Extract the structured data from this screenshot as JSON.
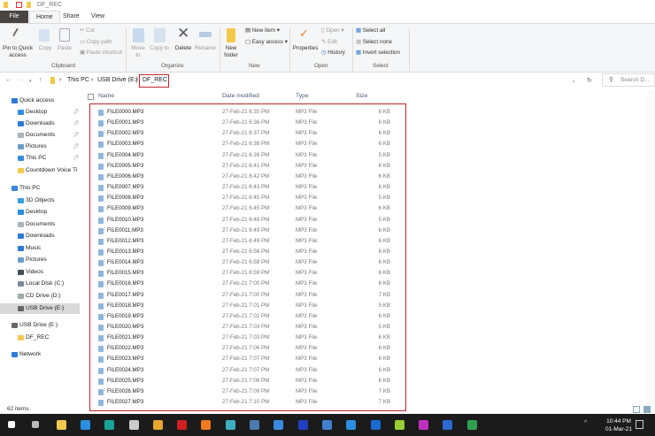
{
  "window": {
    "title": "DF_REC"
  },
  "tabs": [
    "File",
    "Home",
    "Share",
    "View"
  ],
  "ribbon": {
    "clipboard": {
      "pin": "Pin to Quick access",
      "copy": "Copy",
      "paste": "Paste",
      "cut": "Cut",
      "copy_path": "Copy path",
      "paste_shortcut": "Paste shortcut",
      "label": "Clipboard"
    },
    "organize": {
      "move_to": "Move to",
      "copy_to": "Copy to",
      "delete": "Delete",
      "rename": "Rename",
      "label": "Organize"
    },
    "new": {
      "new_folder": "New folder",
      "new_item": "New item",
      "easy_access": "Easy access",
      "label": "New"
    },
    "open": {
      "properties": "Properties",
      "open": "Open",
      "edit": "Edit",
      "history": "History",
      "label": "Open"
    },
    "select": {
      "select_all": "Select all",
      "select_none": "Select none",
      "invert": "Invert selection",
      "label": "Select"
    }
  },
  "address": {
    "crumbs": [
      "This PC",
      "USB Drive (E:)"
    ],
    "current": "DF_REC",
    "search_placeholder": "Search D..."
  },
  "sidebar": {
    "items": [
      {
        "label": "Quick access",
        "level": 0,
        "icon": "star-icon",
        "color": "#2b7cd3"
      },
      {
        "label": "Desktop",
        "level": 1,
        "icon": "desktop-icon",
        "color": "#2b8ee0",
        "pinned": true
      },
      {
        "label": "Downloads",
        "level": 1,
        "icon": "download-icon",
        "color": "#2b7cd3",
        "pinned": true
      },
      {
        "label": "Documents",
        "level": 1,
        "icon": "documents-icon",
        "color": "#aab4c0",
        "pinned": true
      },
      {
        "label": "Pictures",
        "level": 1,
        "icon": "pictures-icon",
        "color": "#6a9ccc",
        "pinned": true
      },
      {
        "label": "This PC",
        "level": 1,
        "icon": "computer-icon",
        "color": "#3a8ad8",
        "pinned": true
      },
      {
        "label": "Countdown Voice Ti",
        "level": 1,
        "icon": "folder-icon",
        "color": "#f2c94c"
      },
      {
        "label": "This PC",
        "level": 0,
        "icon": "computer-icon",
        "color": "#3a8ad8"
      },
      {
        "label": "3D Objects",
        "level": 1,
        "icon": "cube-icon",
        "color": "#35a0e0"
      },
      {
        "label": "Desktop",
        "level": 1,
        "icon": "desktop-icon",
        "color": "#2b8ee0"
      },
      {
        "label": "Documents",
        "level": 1,
        "icon": "documents-icon",
        "color": "#aab4c0"
      },
      {
        "label": "Downloads",
        "level": 1,
        "icon": "download-icon",
        "color": "#2b7cd3"
      },
      {
        "label": "Music",
        "level": 1,
        "icon": "music-icon",
        "color": "#2b7cd3"
      },
      {
        "label": "Pictures",
        "level": 1,
        "icon": "pictures-icon",
        "color": "#6a9ccc"
      },
      {
        "label": "Videos",
        "level": 1,
        "icon": "videos-icon",
        "color": "#444c5a"
      },
      {
        "label": "Local Disk (C:)",
        "level": 1,
        "icon": "disk-icon",
        "color": "#7a8a9a"
      },
      {
        "label": "CD Drive (D:)",
        "level": 1,
        "icon": "cd-icon",
        "color": "#9aa"
      },
      {
        "label": "USB Drive (E:)",
        "level": 1,
        "icon": "usb-drive-icon",
        "color": "#666",
        "selected": true
      },
      {
        "label": "USB Drive (E:)",
        "level": 0,
        "icon": "usb-drive-icon",
        "color": "#666"
      },
      {
        "label": "DF_REC",
        "level": 1,
        "icon": "folder-icon",
        "color": "#f2c94c"
      },
      {
        "label": "Network",
        "level": 0,
        "icon": "network-icon",
        "color": "#2b7cd3"
      }
    ]
  },
  "columns": [
    "Name",
    "Date modified",
    "Type",
    "Size"
  ],
  "files": [
    {
      "name": "FILE0000.MP3",
      "date": "27-Feb-21 6:35 PM",
      "type": "MP3 File",
      "size": "6 KB"
    },
    {
      "name": "FILE0001.MP3",
      "date": "27-Feb-21 6:36 PM",
      "type": "MP3 File",
      "size": "6 KB"
    },
    {
      "name": "FILE0002.MP3",
      "date": "27-Feb-21 6:37 PM",
      "type": "MP3 File",
      "size": "6 KB"
    },
    {
      "name": "FILE0003.MP3",
      "date": "27-Feb-21 6:38 PM",
      "type": "MP3 File",
      "size": "6 KB"
    },
    {
      "name": "FILE0004.MP3",
      "date": "27-Feb-21 6:39 PM",
      "type": "MP3 File",
      "size": "5 KB"
    },
    {
      "name": "FILE0005.MP3",
      "date": "27-Feb-21 6:41 PM",
      "type": "MP3 File",
      "size": "6 KB"
    },
    {
      "name": "FILE0006.MP3",
      "date": "27-Feb-21 6:42 PM",
      "type": "MP3 File",
      "size": "6 KB"
    },
    {
      "name": "FILE0007.MP3",
      "date": "27-Feb-21 6:43 PM",
      "type": "MP3 File",
      "size": "6 KB"
    },
    {
      "name": "FILE0008.MP3",
      "date": "27-Feb-21 6:45 PM",
      "type": "MP3 File",
      "size": "5 KB"
    },
    {
      "name": "FILE0009.MP3",
      "date": "27-Feb-21 6:45 PM",
      "type": "MP3 File",
      "size": "6 KB"
    },
    {
      "name": "FILE0010.MP3",
      "date": "27-Feb-21 6:48 PM",
      "type": "MP3 File",
      "size": "5 KB"
    },
    {
      "name": "FILE0011.MP3",
      "date": "27-Feb-21 6:49 PM",
      "type": "MP3 File",
      "size": "6 KB"
    },
    {
      "name": "FILE0012.MP3",
      "date": "27-Feb-21 6:49 PM",
      "type": "MP3 File",
      "size": "6 KB"
    },
    {
      "name": "FILE0013.MP3",
      "date": "27-Feb-21 6:58 PM",
      "type": "MP3 File",
      "size": "6 KB"
    },
    {
      "name": "FILE0014.MP3",
      "date": "27-Feb-21 6:58 PM",
      "type": "MP3 File",
      "size": "6 KB"
    },
    {
      "name": "FILE0015.MP3",
      "date": "27-Feb-21 6:59 PM",
      "type": "MP3 File",
      "size": "6 KB"
    },
    {
      "name": "FILE0016.MP3",
      "date": "27-Feb-21 7:00 PM",
      "type": "MP3 File",
      "size": "6 KB"
    },
    {
      "name": "FILE0017.MP3",
      "date": "27-Feb-21 7:00 PM",
      "type": "MP3 File",
      "size": "7 KB"
    },
    {
      "name": "FILE0018.MP3",
      "date": "27-Feb-21 7:01 PM",
      "type": "MP3 File",
      "size": "5 KB"
    },
    {
      "name": "FILE0019.MP3",
      "date": "27-Feb-21 7:02 PM",
      "type": "MP3 File",
      "size": "6 KB"
    },
    {
      "name": "FILE0020.MP3",
      "date": "27-Feb-21 7:03 PM",
      "type": "MP3 File",
      "size": "5 KB"
    },
    {
      "name": "FILE0021.MP3",
      "date": "27-Feb-21 7:03 PM",
      "type": "MP3 File",
      "size": "6 KB"
    },
    {
      "name": "FILE0022.MP3",
      "date": "27-Feb-21 7:06 PM",
      "type": "MP3 File",
      "size": "6 KB"
    },
    {
      "name": "FILE0023.MP3",
      "date": "27-Feb-21 7:07 PM",
      "type": "MP3 File",
      "size": "6 KB"
    },
    {
      "name": "FILE0024.MP3",
      "date": "27-Feb-21 7:07 PM",
      "type": "MP3 File",
      "size": "6 KB"
    },
    {
      "name": "FILE0025.MP3",
      "date": "27-Feb-21 7:08 PM",
      "type": "MP3 File",
      "size": "6 KB"
    },
    {
      "name": "FILE0026.MP3",
      "date": "27-Feb-21 7:09 PM",
      "type": "MP3 File",
      "size": "7 KB"
    },
    {
      "name": "FILE0027.MP3",
      "date": "27-Feb-21 7:10 PM",
      "type": "MP3 File",
      "size": "7 KB"
    }
  ],
  "status": {
    "count": "62 items"
  },
  "taskbar": {
    "apps": [
      {
        "icon": "start-icon",
        "color": "#ffffff"
      },
      {
        "icon": "task-view-icon",
        "color": "#bbbbbb"
      },
      {
        "icon": "file-explorer-icon",
        "color": "#f2c94c"
      },
      {
        "icon": "app-icon",
        "color": "#2b8ee0"
      },
      {
        "icon": "app-icon",
        "color": "#1aa39a"
      },
      {
        "icon": "calculator-icon",
        "color": "#cccccc"
      },
      {
        "icon": "chrome-icon",
        "color": "#e8a530"
      },
      {
        "icon": "app-icon",
        "color": "#d02020"
      },
      {
        "icon": "firefox-icon",
        "color": "#f07a20"
      },
      {
        "icon": "app-icon",
        "color": "#3ab0c0"
      },
      {
        "icon": "app-icon",
        "color": "#4a7ab0"
      },
      {
        "icon": "app-icon",
        "color": "#3a8ae0"
      },
      {
        "icon": "app-icon",
        "color": "#2040c0"
      },
      {
        "icon": "network-app-icon",
        "color": "#4080d0"
      },
      {
        "icon": "onedrive-icon",
        "color": "#2b8ee0"
      },
      {
        "icon": "app-icon",
        "color": "#1a6ad0"
      },
      {
        "icon": "app-icon",
        "color": "#9acd32"
      },
      {
        "icon": "app-icon",
        "color": "#c030c0"
      },
      {
        "icon": "app-icon",
        "color": "#2b6ad0"
      },
      {
        "icon": "app-icon",
        "color": "#30a050"
      }
    ],
    "time": "10:44 PM",
    "date": "01-Mar-21"
  }
}
